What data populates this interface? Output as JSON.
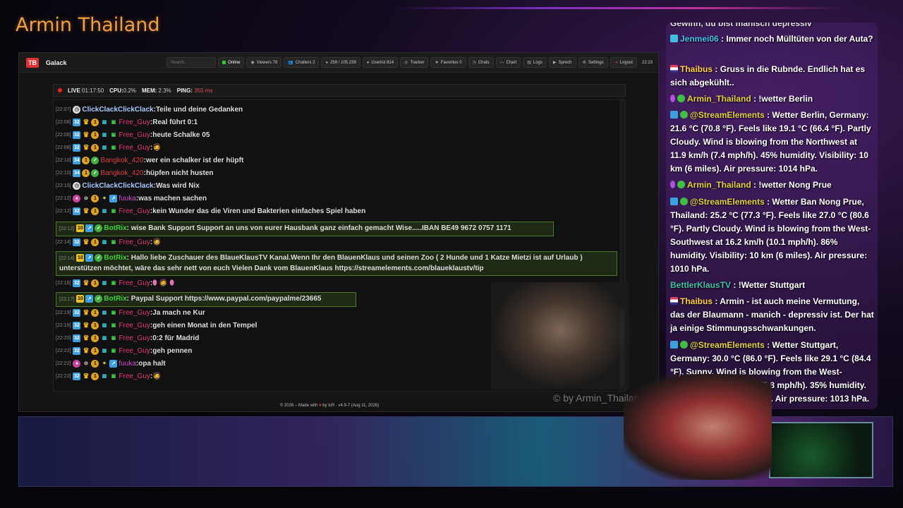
{
  "stream_title": "Armin Thailand",
  "app": {
    "logo": "TB",
    "brand": "Galack",
    "search_placeholder": "Search...",
    "toolbar": [
      {
        "label": "Online",
        "icon": "status-dot-icon"
      },
      {
        "label": "Viewers 78",
        "icon": "eye-icon"
      },
      {
        "label": "Chatters 2",
        "icon": "users-icon"
      },
      {
        "label": "259 / 105.239",
        "icon": "chat-bubble-icon"
      },
      {
        "label": "Userlist 814",
        "icon": "user-icon"
      },
      {
        "label": "Tracker",
        "icon": "target-icon"
      },
      {
        "label": "Favorites 0",
        "icon": "star-icon"
      },
      {
        "label": "Chats",
        "icon": "clock-icon"
      },
      {
        "label": "Chart",
        "icon": "chart-icon"
      },
      {
        "label": "Logs",
        "icon": "log-icon"
      },
      {
        "label": "Sprech",
        "icon": "speech-icon"
      },
      {
        "label": "Settings",
        "icon": "gear-icon"
      },
      {
        "label": "Logout",
        "icon": "logout-icon"
      }
    ],
    "clock": "22:23",
    "status": {
      "live_label": "LIVE",
      "live_time": "01:17:50",
      "cpu_label": "CPU:",
      "cpu_value": "0.2%",
      "mem_label": "MEM:",
      "mem_value": "2.3%",
      "ping_label": "PING:",
      "ping_value": "355 ms"
    }
  },
  "chat": [
    {
      "ts": "[22:07]",
      "user": "ClickClackClickClack",
      "text": "Teile und deine Gedanken"
    },
    {
      "ts": "[22:08]",
      "user": "Free_Guy",
      "text": "Real führt 0:1"
    },
    {
      "ts": "[22:08]",
      "user": "Free_Guy",
      "text": "heute Schalke 05"
    },
    {
      "ts": "[22:08]",
      "user": "Free_Guy",
      "text": ""
    },
    {
      "ts": "[22:10]",
      "user": "Bangkok_420",
      "text": "wer ein schalker ist der hüpft"
    },
    {
      "ts": "[22:10]",
      "user": "Bangkok_420",
      "text": "hüpfen nicht husten"
    },
    {
      "ts": "[22:10]",
      "user": "ClickClackClickClack",
      "text": "Was wird Nix"
    },
    {
      "ts": "[22:12]",
      "user": "fuuka",
      "text": "was machen sachen"
    },
    {
      "ts": "[22:12]",
      "user": "Free_Guy",
      "text": "kein Wunder das die Viren und Bakterien einfaches Spiel haben"
    },
    {
      "ts": "[22:12]",
      "user": "BotRix",
      "text": "wise Bank Support Support an uns von eurer Hausbank ganz einfach gemacht Wise.....IBAN BE49 9672 0757 1171"
    },
    {
      "ts": "[22:14]",
      "user": "Free_Guy",
      "text": ""
    },
    {
      "ts": "[22:14]",
      "user": "BotRix",
      "text": "Hallo liebe Zuschauer des BlaueKlausTV Kanal.Wenn Ihr den BlauenKlaus und seinen Zoo ( 2 Hunde und 1 Katze Mietzi ist auf Urlaub ) unterstützen möchtet, wäre das sehr nett von euch Vielen Dank vom BlauenKlaus https://streamelements.com/blaueklaustv/tip"
    },
    {
      "ts": "[22:16]",
      "user": "Free_Guy",
      "text": ""
    },
    {
      "ts": "[22:17]",
      "user": "BotRix",
      "text": "Paypal Support https://www.paypal.com/paypalme/23665"
    },
    {
      "ts": "[22:19]",
      "user": "Free_Guy",
      "text": "Ja mach ne Kur"
    },
    {
      "ts": "[22:19]",
      "user": "Free_Guy",
      "text": "geh einen Monat in den Tempel"
    },
    {
      "ts": "[22:20]",
      "user": "Free_Guy",
      "text": "0:2 für Madrid"
    },
    {
      "ts": "[22:22]",
      "user": "Free_Guy",
      "text": "geh pennen"
    },
    {
      "ts": "[22:22]",
      "user": "fuuka",
      "text": "opa halt"
    },
    {
      "ts": "[22:22]",
      "user": "Free_Guy",
      "text": ""
    }
  ],
  "webcam_label": "© by Armin_Thailand",
  "footer": {
    "prefix": "© 2026 – Made with",
    "suffix": "by tcR · v4.9-7 (Aug 11, 2026)"
  },
  "overlay": [
    {
      "user": "",
      "text": "Gewinn, du bist manisch depressiv"
    },
    {
      "user": "Jenmei06",
      "text": ": Immer noch Mülltüten von der Auta?"
    },
    {
      "user": "Thaibus",
      "text": ": Gruss in die Rubnde. Endlich hat es sich abgekühlt.."
    },
    {
      "user": "Armin_Thailand",
      "text": ": !wetter Berlin"
    },
    {
      "user": "@StreamElements",
      "text": ": Wetter Berlin, Germany: 21.6 °C (70.8 °F). Feels like 19.1 °C (66.4 °F). Partly Cloudy. Wind is blowing from the Northwest at 11.9 km/h (7.4 mph/h). 45% humidity. Visibility: 10 km (6 miles). Air pressure: 1014 hPa."
    },
    {
      "user": "Armin_Thailand",
      "text": ": !wetter Nong Prue"
    },
    {
      "user": "@StreamElements",
      "text": ": Wetter Ban Nong Prue, Thailand: 25.2 °C (77.3 °F). Feels like 27.0 °C (80.6 °F). Partly Cloudy. Wind is blowing from the West-Southwest at 16.2 km/h (10.1 mph/h). 86% humidity. Visibility: 10 km (6 miles). Air pressure: 1010 hPa."
    },
    {
      "user": "BettlerKlausTV",
      "text": ": !Wetter Stuttgart"
    },
    {
      "user": "Thaibus",
      "text": ": Armin - ist auch meine Vermutung, das der Blaumann - manich - depressiv ist. Der hat ja einige Stimmungsschwankungen."
    },
    {
      "user": "@StreamElements",
      "text": ": Wetter Stuttgart, Germany: 30.0 °C (86.0 °F). Feels like 29.1 °C (84.4 °F). Sunny. Wind is blowing from the West-Northwest at 9.4 km/h (5.8 mph/h). 35% humidity. Visibility: 10 km (6 miles). Air pressure: 1013 hPa."
    }
  ]
}
